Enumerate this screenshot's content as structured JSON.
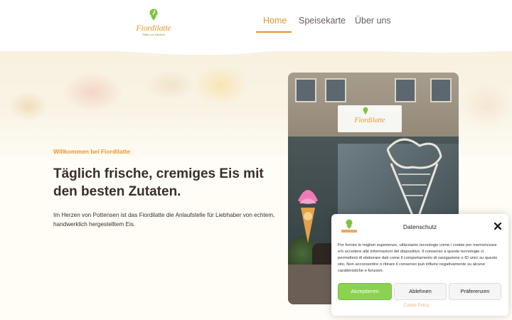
{
  "brand": {
    "logo_word": "Fiordilatte",
    "logo_sub": "Gelato con Passione",
    "accent": "#e8962f",
    "green": "#8ad24f"
  },
  "nav": {
    "items": [
      {
        "label": "Home",
        "active": true
      },
      {
        "label": "Speisekarte",
        "active": false
      },
      {
        "label": "Über uns",
        "active": false
      }
    ]
  },
  "hero": {
    "eyebrow": "Willkommen bei Fiordilatte",
    "headline": "Täglich frische, cremiges Eis mit den besten Zutaten.",
    "lead": "Im Herzen von Pottensen ist das Fiordilatte die Anlaufstelle für Liebhaber von echtem, handwerklich hergestelltem Eis.",
    "photo_sign": "Fiordilatte"
  },
  "cookie": {
    "title": "Datenschutz",
    "text": "Per fornire le migliori esperienze, utilizziamo tecnologie come i cookie per memorizzare e/o accedere alle informazioni del dispositivo. Il consenso a queste tecnologie ci permetterà di elaborare dati come il comportamento di navigazione o ID unici su questo sito. Non acconsentire o ritirare il consenso può influire negativamente su alcune caratteristiche e funzioni.",
    "accept_label": "Akzeptieren",
    "deny_label": "Ablehnen",
    "prefs_label": "Präferenzen",
    "policy_link": "Cookie Policy",
    "close_icon": "close-icon"
  }
}
